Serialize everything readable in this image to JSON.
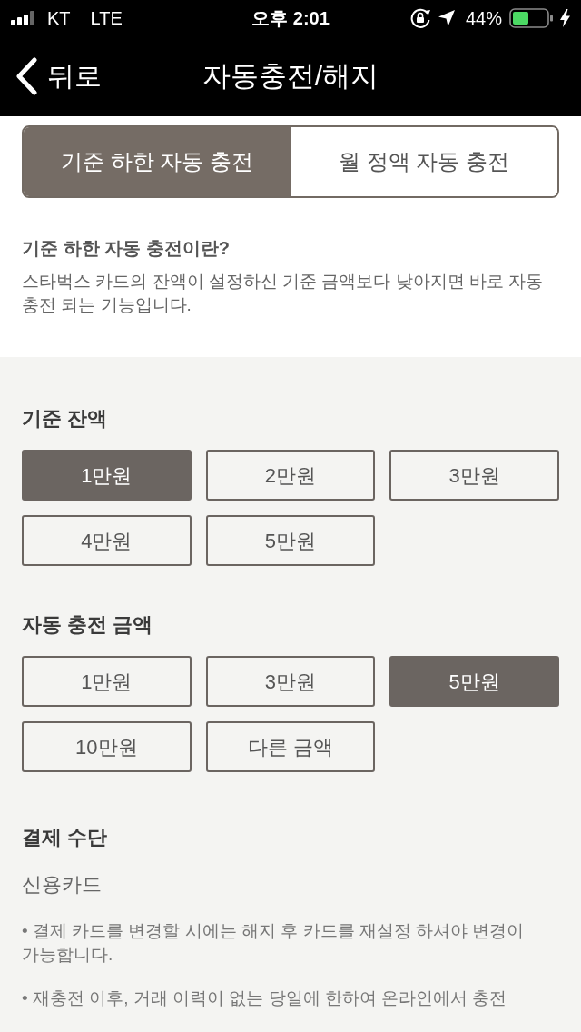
{
  "status_bar": {
    "carrier": "KT",
    "network": "LTE",
    "time": "오후 2:01",
    "battery": "44%"
  },
  "header": {
    "back": "뒤로",
    "title": "자동충전/해지"
  },
  "tabs": [
    {
      "label": "기준 하한 자동 충전",
      "selected": true
    },
    {
      "label": "월 정액 자동 충전",
      "selected": false
    }
  ],
  "intro": {
    "heading": "기준 하한 자동 충전이란?",
    "text": "스타벅스 카드의 잔액이 설정하신 기준 금액보다 낮아지면 바로 자동 충전 되는 기능입니다."
  },
  "threshold": {
    "heading": "기준 잔액",
    "options": [
      {
        "label": "1만원",
        "selected": true
      },
      {
        "label": "2만원",
        "selected": false
      },
      {
        "label": "3만원",
        "selected": false
      },
      {
        "label": "4만원",
        "selected": false
      },
      {
        "label": "5만원",
        "selected": false
      }
    ]
  },
  "charge_amount": {
    "heading": "자동 충전 금액",
    "options": [
      {
        "label": "1만원",
        "selected": false
      },
      {
        "label": "3만원",
        "selected": false
      },
      {
        "label": "5만원",
        "selected": true
      },
      {
        "label": "10만원",
        "selected": false
      },
      {
        "label": "다른 금액",
        "selected": false
      }
    ]
  },
  "payment": {
    "heading": "결제 수단",
    "method": "신용카드",
    "notes": [
      "• 결제 카드를 변경할 시에는 해지 후 카드를 재설정 하셔야 변경이 가능합니다.",
      "• 재충전 이후, 거래 이력이 없는 당일에 한하여 온라인에서 충전"
    ]
  }
}
